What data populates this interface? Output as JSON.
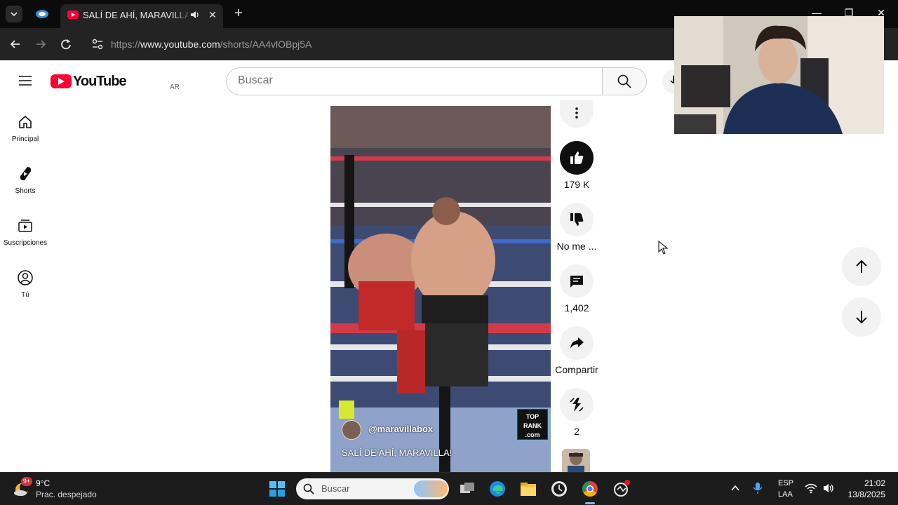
{
  "browser": {
    "active_tab_title": "SALÍ DE AHÍ, MARAVILLA! - YouTube",
    "close_tab_glyph": "✕",
    "new_tab_glyph": "+",
    "url_prefix": "https://",
    "url_host": "www.youtube.com",
    "url_path": "/shorts/AA4vlOBpj5A"
  },
  "youtube": {
    "logo_text": "YouTube",
    "country_code": "AR",
    "search_placeholder": "Buscar"
  },
  "sidebar": {
    "items": [
      {
        "label": "Principal",
        "icon": "home-icon"
      },
      {
        "label": "Shorts",
        "icon": "shorts-icon"
      },
      {
        "label": "Suscripciones",
        "icon": "subscriptions-icon"
      },
      {
        "label": "Tú",
        "icon": "you-icon"
      }
    ]
  },
  "short": {
    "channel_handle": "@maravillabox",
    "caption": "SALÍ DE AHÍ, MARAVILLA!",
    "badge_line1": "TOP",
    "badge_line2": "RANK",
    "badge_line3": ".com"
  },
  "actions": {
    "like_count": "179 K",
    "dislike_label": "No me ...",
    "comments_count": "1,402",
    "share_label": "Compartir",
    "remix_count": "2"
  },
  "window_controls": {
    "minimize": "—",
    "maximize": "❐",
    "close": "✕"
  },
  "taskbar": {
    "weather_badge": "9+",
    "weather_temp": "9°C",
    "weather_desc": "Prac. despejado",
    "search_text": "Buscar",
    "lang_line1": "ESP",
    "lang_line2": "LAA",
    "time": "21:02",
    "date": "13/8/2025"
  },
  "colors": {
    "youtube_red": "#ff0033",
    "chrome_dark": "#232323",
    "tabbar": "#0b0b0b",
    "taskbar": "#1c1c1c"
  }
}
